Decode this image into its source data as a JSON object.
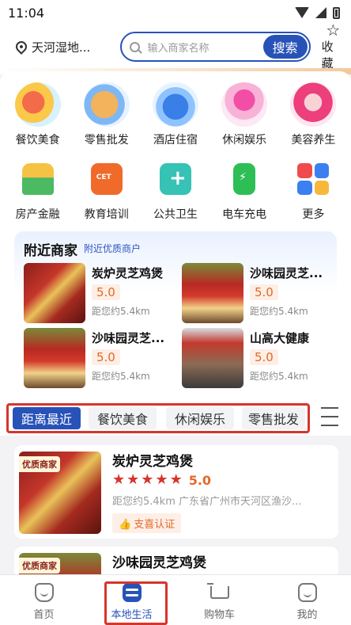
{
  "status_bar": {
    "time": "11:04"
  },
  "header": {
    "location": "天河湿地...",
    "search_placeholder": "输入商家名称",
    "search_button": "搜索",
    "favorite": "收藏"
  },
  "categories": [
    {
      "label": "餐饮美食",
      "icon": "food-icon"
    },
    {
      "label": "零售批发",
      "icon": "retail-icon"
    },
    {
      "label": "酒店住宿",
      "icon": "hotel-icon"
    },
    {
      "label": "休闲娱乐",
      "icon": "cocktail-icon"
    },
    {
      "label": "美容养生",
      "icon": "beauty-icon"
    },
    {
      "label": "房产金融",
      "icon": "house-icon"
    },
    {
      "label": "教育培训",
      "icon": "education-icon"
    },
    {
      "label": "公共卫生",
      "icon": "health-icon"
    },
    {
      "label": "电车充电",
      "icon": "charging-icon"
    },
    {
      "label": "更多",
      "icon": "more-icon"
    }
  ],
  "nearby": {
    "title": "附近商家",
    "subtitle": "附近优质商户",
    "shops": [
      {
        "name": "炭炉灵芝鸡煲",
        "rating": "5.0",
        "distance": "距您约5.4km"
      },
      {
        "name": "沙味园灵芝...",
        "rating": "5.0",
        "distance": "距您约5.4km"
      },
      {
        "name": "沙味园灵芝...",
        "rating": "5.0",
        "distance": "距您约5.4km"
      },
      {
        "name": "山高大健康",
        "rating": "5.0",
        "distance": "距您约5.4km"
      }
    ]
  },
  "filter_tabs": [
    "距离最近",
    "餐饮美食",
    "休闲娱乐",
    "零售批发"
  ],
  "active_filter": "距离最近",
  "list": [
    {
      "tag": "优质商家",
      "name": "炭炉灵芝鸡煲",
      "score": "5.0",
      "stars": 5,
      "address": "距您约5.4km 广东省广州市天河区渔沙...",
      "verify": "支喜认证"
    },
    {
      "tag": "优质商家",
      "name": "沙味园灵芝鸡煲"
    }
  ],
  "bottom_nav": {
    "items": [
      "首页",
      "本地生活",
      "购物车",
      "我的"
    ],
    "active": "本地生活"
  },
  "colors": {
    "primary": "#2852b8",
    "highlight": "#d6352c",
    "rating": "#e26a28"
  }
}
